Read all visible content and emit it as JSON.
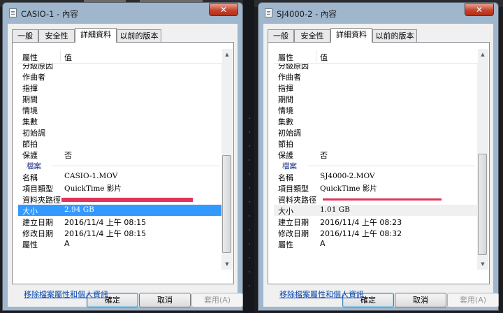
{
  "windows": [
    {
      "title": "CASIO-1 - 內容",
      "close_glyph": "✕",
      "tabs": [
        "一般",
        "安全性",
        "詳細資料",
        "以前的版本"
      ],
      "active_tab": 2,
      "header": {
        "property": "屬性",
        "value": "值"
      },
      "rows": [
        {
          "kind": "prop",
          "label": "分級原因",
          "value": ""
        },
        {
          "kind": "prop",
          "label": "作曲者",
          "value": ""
        },
        {
          "kind": "prop",
          "label": "指揮",
          "value": ""
        },
        {
          "kind": "prop",
          "label": "期間",
          "value": ""
        },
        {
          "kind": "prop",
          "label": "情境",
          "value": ""
        },
        {
          "kind": "prop",
          "label": "集數",
          "value": ""
        },
        {
          "kind": "prop",
          "label": "初始調",
          "value": ""
        },
        {
          "kind": "prop",
          "label": "節拍",
          "value": ""
        },
        {
          "kind": "prop",
          "label": "保護",
          "value": "否"
        },
        {
          "kind": "group",
          "label": "檔案"
        },
        {
          "kind": "prop",
          "label": "名稱",
          "value": "CASIO-1.MOV",
          "serif": true
        },
        {
          "kind": "prop",
          "label": "項目類型",
          "value": "QuickTime 影片",
          "serif": true
        },
        {
          "kind": "redacted",
          "label": "資料夾路徑"
        },
        {
          "kind": "prop",
          "label": "大小",
          "value": "2.94 GB",
          "serif": true,
          "selected": true
        },
        {
          "kind": "prop",
          "label": "建立日期",
          "value": "2016/11/4 上午 08:15"
        },
        {
          "kind": "prop",
          "label": "修改日期",
          "value": "2016/11/4 上午 08:15"
        },
        {
          "kind": "prop",
          "label": "屬性",
          "value": "A"
        }
      ],
      "remove_link": "移除檔案屬性和個人資訊",
      "buttons": {
        "ok": "確定",
        "cancel": "取消",
        "apply": "套用(A)"
      }
    },
    {
      "title": "SJ4000-2 - 內容",
      "close_glyph": "✕",
      "tabs": [
        "一般",
        "安全性",
        "詳細資料",
        "以前的版本"
      ],
      "active_tab": 2,
      "header": {
        "property": "屬性",
        "value": "值"
      },
      "rows": [
        {
          "kind": "prop",
          "label": "分級原因",
          "value": ""
        },
        {
          "kind": "prop",
          "label": "作曲者",
          "value": ""
        },
        {
          "kind": "prop",
          "label": "指揮",
          "value": ""
        },
        {
          "kind": "prop",
          "label": "期間",
          "value": ""
        },
        {
          "kind": "prop",
          "label": "情境",
          "value": ""
        },
        {
          "kind": "prop",
          "label": "集數",
          "value": ""
        },
        {
          "kind": "prop",
          "label": "初始調",
          "value": ""
        },
        {
          "kind": "prop",
          "label": "節拍",
          "value": ""
        },
        {
          "kind": "prop",
          "label": "保護",
          "value": "否"
        },
        {
          "kind": "group",
          "label": "檔案"
        },
        {
          "kind": "prop",
          "label": "名稱",
          "value": "SJ4000-2.MOV",
          "serif": true
        },
        {
          "kind": "prop",
          "label": "項目類型",
          "value": "QuickTime 影片",
          "serif": true
        },
        {
          "kind": "redacted",
          "label": "資料夾路徑"
        },
        {
          "kind": "prop",
          "label": "大小",
          "value": "1.01 GB",
          "serif": true,
          "gray": true
        },
        {
          "kind": "prop",
          "label": "建立日期",
          "value": "2016/11/4 上午 08:23"
        },
        {
          "kind": "prop",
          "label": "修改日期",
          "value": "2016/11/4 上午 08:32"
        },
        {
          "kind": "prop",
          "label": "屬性",
          "value": "A"
        }
      ],
      "remove_link": "移除檔案屬性和個人資訊",
      "buttons": {
        "ok": "確定",
        "cancel": "取消",
        "apply": "套用(A)"
      }
    }
  ],
  "colors": {
    "selection": "#3399ff",
    "redaction": "#e0345a",
    "link": "#0645ad"
  }
}
